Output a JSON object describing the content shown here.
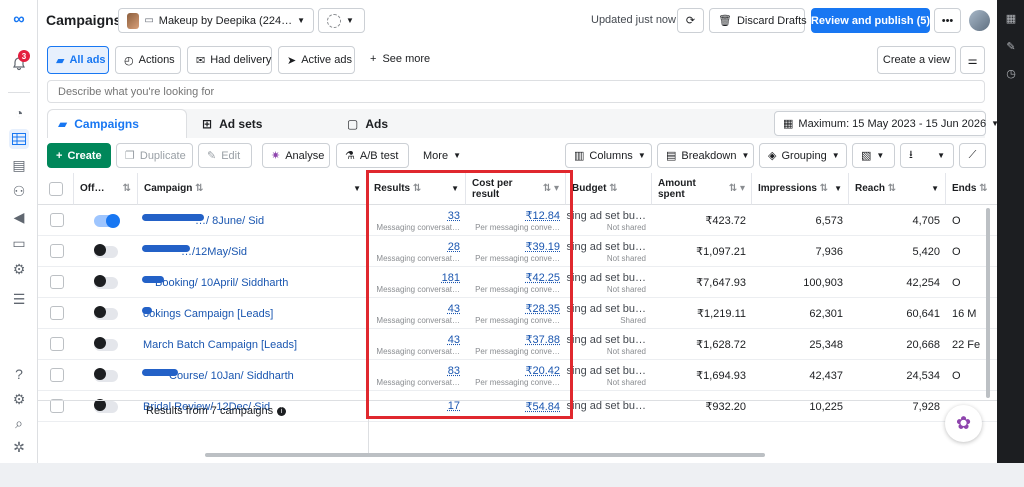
{
  "header": {
    "title": "Campaigns",
    "account": "Makeup by Deepika (224…",
    "updated": "Updated just now",
    "discard": "Discard Drafts",
    "publish": "Review and publish (5)",
    "more": "•••"
  },
  "notifications": {
    "count": "3"
  },
  "filters": {
    "all_ads": "All ads",
    "actions": "Actions",
    "had_delivery": "Had delivery",
    "active_ads": "Active ads",
    "see_more": "See more",
    "create_view": "Create a view"
  },
  "search": {
    "placeholder": "Describe what you're looking for"
  },
  "tabs": {
    "campaigns": "Campaigns",
    "ad_sets": "Ad sets",
    "ads": "Ads"
  },
  "date_range": "Maximum: 15 May 2023 - 15 Jun 2026",
  "toolbar": {
    "create": "Create",
    "duplicate": "Duplicate",
    "edit": "Edit",
    "analyse": "Analyse",
    "ab_test": "A/B test",
    "more": "More",
    "columns": "Columns",
    "breakdown": "Breakdown",
    "grouping": "Grouping"
  },
  "columns": {
    "off_on": "Off…",
    "campaign": "Campaign",
    "results": "Results",
    "cost_per_result": "Cost per result",
    "budget": "Budget",
    "amount_spent": "Amount spent",
    "impressions": "Impressions",
    "reach": "Reach",
    "ends": "Ends"
  },
  "rows": [
    {
      "campaign": "…/ 8June/ Sid",
      "results": "33",
      "results_sub": "Messaging conversat…",
      "cost": "₹12.84",
      "cost_sub": "Per messaging conve…",
      "budget": "Using ad set bu…",
      "budget_sub": "Not shared",
      "spent": "₹423.72",
      "impressions": "6,573",
      "reach": "4,705",
      "ends": "O",
      "on": true
    },
    {
      "campaign": "…/12May/Sid",
      "results": "28",
      "results_sub": "Messaging conversat…",
      "cost": "₹39.19",
      "cost_sub": "Per messaging conve…",
      "budget": "Using ad set bu…",
      "budget_sub": "Not shared",
      "spent": "₹1,097.21",
      "impressions": "7,936",
      "reach": "5,420",
      "ends": "O",
      "on": false
    },
    {
      "campaign": "Booking/ 10April/ Siddharth",
      "results": "181",
      "results_sub": "Messaging conversat…",
      "cost": "₹42.25",
      "cost_sub": "Per messaging conve…",
      "budget": "Using ad set bu…",
      "budget_sub": "Not shared",
      "spent": "₹7,647.93",
      "impressions": "100,903",
      "reach": "42,254",
      "ends": "O",
      "on": false
    },
    {
      "campaign": "ookings Campaign [Leads]",
      "results": "43",
      "results_sub": "Messaging conversat…",
      "cost": "₹28.35",
      "cost_sub": "Per messaging conve…",
      "budget": "Using ad set bu…",
      "budget_sub": "Shared",
      "spent": "₹1,219.11",
      "impressions": "62,301",
      "reach": "60,641",
      "ends": "16 M",
      "on": false
    },
    {
      "campaign": "March Batch Campaign [Leads]",
      "results": "43",
      "results_sub": "Messaging conversat…",
      "cost": "₹37.88",
      "cost_sub": "Per messaging conve…",
      "budget": "Using ad set bu…",
      "budget_sub": "Not shared",
      "spent": "₹1,628.72",
      "impressions": "25,348",
      "reach": "20,668",
      "ends": "22 Fe",
      "on": false
    },
    {
      "campaign": "Course/ 10Jan/ Siddharth",
      "results": "83",
      "results_sub": "Messaging conversat…",
      "cost": "₹20.42",
      "cost_sub": "Per messaging conve…",
      "budget": "Using ad set bu…",
      "budget_sub": "Not shared",
      "spent": "₹1,694.93",
      "impressions": "42,437",
      "reach": "24,534",
      "ends": "O",
      "on": false
    },
    {
      "campaign": "Bridal Review/ 12Dec/ Sid",
      "results": "17",
      "results_sub": "",
      "cost": "₹54.84",
      "cost_sub": "",
      "budget": "Using ad set bu…",
      "budget_sub": "",
      "spent": "₹932.20",
      "impressions": "10,225",
      "reach": "7,928",
      "ends": "",
      "on": false
    }
  ],
  "summary": "Results from 7 campaigns",
  "colors": {
    "accent": "#1877f2",
    "create": "#00875a",
    "highlight": "#e0282e"
  }
}
